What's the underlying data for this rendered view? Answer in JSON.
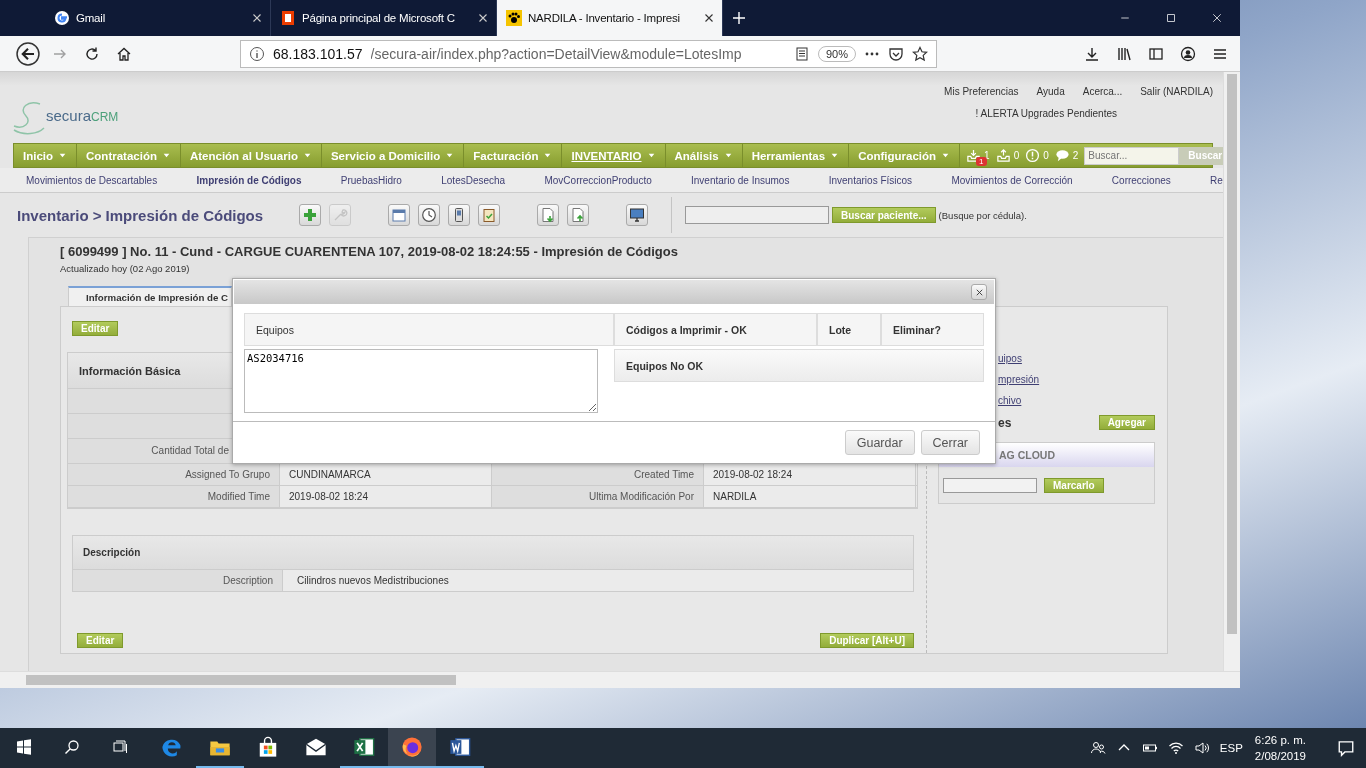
{
  "browser": {
    "tabs": [
      {
        "title": "Gmail",
        "kind": "google",
        "selected": false
      },
      {
        "title": "Página principal de Microsoft C",
        "kind": "office",
        "selected": false
      },
      {
        "title": "NARDILA - Inventario - Impresi",
        "kind": "paw",
        "selected": true
      }
    ],
    "history": {
      "back_disabled": false,
      "forward_disabled": true
    },
    "address": {
      "host": "68.183.101.57",
      "path": "/secura-air/index.php?action=DetailView&module=LotesImp",
      "zoom": "90%"
    }
  },
  "header": {
    "logo": {
      "name": "secura",
      "accent": "CRM"
    },
    "links": [
      "Mis Preferencias",
      "Ayuda",
      "Acerca...",
      "Salir (NARDILA)"
    ],
    "alert": "! ALERTA Upgrades Pendientes"
  },
  "menu": {
    "items": [
      {
        "label": "Inicio",
        "selected": false
      },
      {
        "label": "Contratación",
        "selected": false
      },
      {
        "label": "Atención al Usuario",
        "selected": false
      },
      {
        "label": "Servicio a Domicilio",
        "selected": false
      },
      {
        "label": "Facturación",
        "selected": false
      },
      {
        "label": "INVENTARIO",
        "selected": true
      },
      {
        "label": "Análisis",
        "selected": false
      },
      {
        "label": "Herramientas",
        "selected": false
      },
      {
        "label": "Configuración",
        "selected": false
      }
    ],
    "counters": [
      {
        "kind": "inbox",
        "count": "1",
        "badge": "1"
      },
      {
        "kind": "outbox",
        "count": "0"
      },
      {
        "kind": "alert",
        "count": "0"
      },
      {
        "kind": "chat",
        "count": "2"
      }
    ],
    "search": {
      "placeholder": "Buscar...",
      "button": "Buscar"
    }
  },
  "submenu": [
    {
      "label": "Movimientos de Descartables",
      "selected": false
    },
    {
      "label": "Impresión de Códigos",
      "selected": true
    },
    {
      "label": "PruebasHidro",
      "selected": false
    },
    {
      "label": "LotesDesecha",
      "selected": false
    },
    {
      "label": "MovCorreccionProducto",
      "selected": false
    },
    {
      "label": "Inventario de Insumos",
      "selected": false
    },
    {
      "label": "Inventarios Físicos",
      "selected": false
    },
    {
      "label": "Movimientos de Corrección",
      "selected": false
    },
    {
      "label": "Correcciones",
      "selected": false
    },
    {
      "label": "Re",
      "selected": false
    }
  ],
  "page": {
    "breadcrumb": {
      "module": "Inventario",
      "current": "> Impresión de Códigos"
    },
    "toolbar": [
      [
        {
          "kind": "add",
          "disabled": false
        },
        {
          "kind": "tool",
          "disabled": true
        }
      ],
      [
        {
          "kind": "calendar",
          "disabled": false
        },
        {
          "kind": "clock",
          "disabled": false
        },
        {
          "kind": "device",
          "disabled": false
        },
        {
          "kind": "clipboard",
          "disabled": false
        }
      ],
      [
        {
          "kind": "import",
          "disabled": false
        },
        {
          "kind": "export",
          "disabled": false
        }
      ],
      [
        {
          "kind": "monitor",
          "disabled": false
        }
      ]
    ],
    "patient_search": {
      "button": "Buscar paciente...",
      "hint": "(Busque por cédula)."
    }
  },
  "record": {
    "title": "[ 6099499 ] No. 11 - Cund - CARGUE CUARENTENA 107, 2019-08-02 18:24:55 - Impresión de Códigos",
    "updated": "Actualizado hoy (02 Ago 2019)",
    "tab": {
      "label": "Información de Impresión de C",
      "selected": true
    },
    "basic": {
      "title": "Información Básica",
      "rows": [
        {
          "kind": "covered"
        },
        {
          "kind": "covered"
        },
        {
          "kind": "covered",
          "label": "Cantidad Total de"
        },
        {
          "kind": "full",
          "label": "Assigned To Grupo",
          "value": "CUNDINAMARCA",
          "label2": "Created Time",
          "value2": "2019-08-02 18:24"
        },
        {
          "kind": "full",
          "label": "Modified Time",
          "value": "2019-08-02 18:24",
          "label2": "Ultima Modificación Por",
          "value2": "NARDILA"
        }
      ]
    },
    "description": {
      "title": "Descripción",
      "label": "Description",
      "value": "Cilindros nuevos Medistribuciones"
    },
    "buttons": {
      "edit_top": "Editar",
      "edit_bottom": "Editar",
      "duplicate": "Duplicar [Alt+U]"
    }
  },
  "sidebar": {
    "links": [
      "uipos",
      "mpresión",
      "chivo"
    ],
    "section": "es",
    "add_button": "Agregar",
    "tag_cloud": {
      "title": "AG CLOUD",
      "button": "Marcarlo"
    }
  },
  "dialog": {
    "columns": [
      "Equipos",
      "Códigos a Imprimir - OK",
      "Lote",
      "Eliminar?"
    ],
    "equipos": "AS2034716",
    "not_ok": "Equipos No OK",
    "buttons": [
      "Guardar",
      "Cerrar"
    ]
  },
  "taskbar": {
    "apps": [
      {
        "kind": "edge",
        "running": false,
        "selected": false
      },
      {
        "kind": "explorer",
        "running": true,
        "selected": false
      },
      {
        "kind": "store",
        "running": false,
        "selected": false
      },
      {
        "kind": "mail",
        "running": false,
        "selected": false
      },
      {
        "kind": "excel",
        "running": true,
        "selected": false
      },
      {
        "kind": "firefox",
        "running": true,
        "selected": true
      },
      {
        "kind": "word",
        "running": true,
        "selected": false
      }
    ],
    "tray": {
      "language": "ESP",
      "time": "6:26 p. m.",
      "date": "2/08/2019"
    }
  }
}
